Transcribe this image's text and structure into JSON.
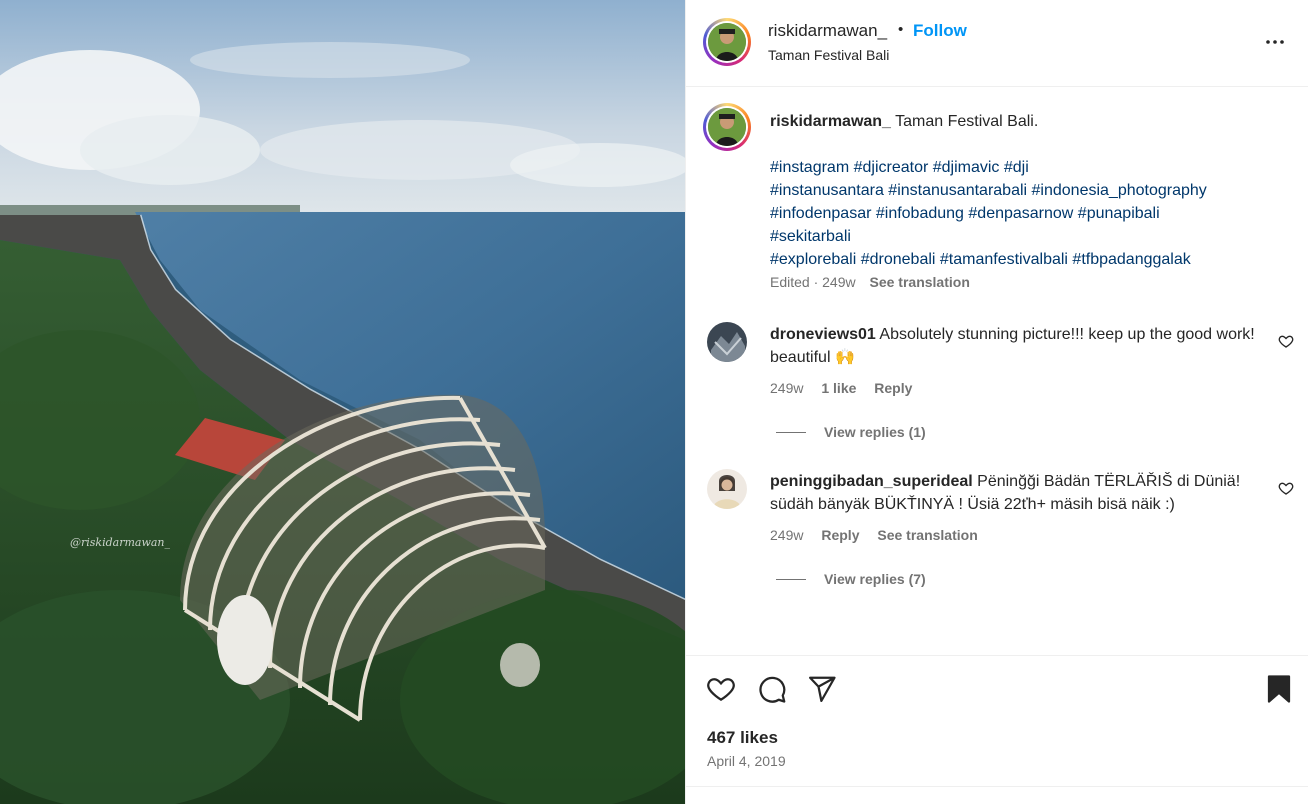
{
  "post": {
    "username": "riskidarmawan_",
    "dot": "•",
    "follow_label": "Follow",
    "location": "Taman Festival Bali",
    "watermark": "@riskidarmawan_"
  },
  "caption": {
    "username": "riskidarmawan_",
    "text": "Taman Festival Bali.",
    "hashtag_lines": [
      "#instagram #djicreator #djimavic #dji",
      "#instanusantara #instanusantarabali #indonesia_photography",
      "#infodenpasar #infobadung #denpasarnow #punapibali",
      "#sekitarbali",
      "#explorebali #dronebali #tamanfestivalbali #tfbpadanggalak"
    ],
    "edited": "Edited · 249w",
    "see_translation": "See translation"
  },
  "comments": [
    {
      "username": "droneviews01",
      "text": "Absolutely stunning picture!!! keep up the good work! beautiful 🙌",
      "time": "249w",
      "likes": "1 like",
      "reply": "Reply",
      "view_replies": "View replies (1)"
    },
    {
      "username": "peninggibadan_superideal",
      "text": "Pëninğği Bädän TËRLÄŘIŠ di Düniä! südäh bänyäk BÜKŤINYÄ ! Üsiä 22ťh+ mäsih bisä näik :)",
      "time": "249w",
      "reply": "Reply",
      "see_translation": "See translation",
      "view_replies": "View replies (7)"
    }
  ],
  "footer": {
    "likes": "467 likes",
    "date": "April 4, 2019"
  },
  "icons": {
    "more": "more-options-icon",
    "like": "heart-icon",
    "comment": "comment-icon",
    "share": "share-icon",
    "save": "bookmark-icon"
  },
  "colors": {
    "link_blue": "#0095f6",
    "hashtag": "#00376b",
    "muted": "#737373"
  }
}
